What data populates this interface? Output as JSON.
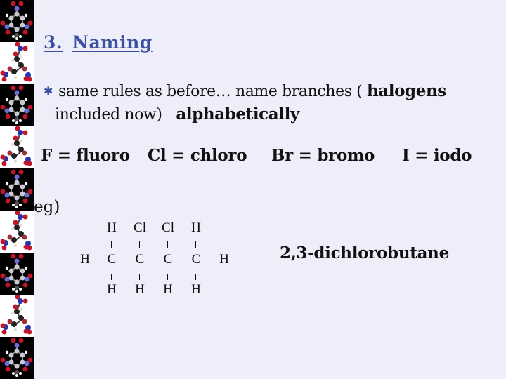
{
  "sidebar": {
    "tiles": [
      {
        "image": "tnt-molecule-icon",
        "background": "#000000"
      },
      {
        "image": "nitroglycerin-molecule-icon",
        "background": "#ffffff"
      },
      {
        "image": "tnt-molecule-icon",
        "background": "#000000"
      },
      {
        "image": "nitroglycerin-molecule-icon",
        "background": "#ffffff"
      },
      {
        "image": "tnt-molecule-icon",
        "background": "#000000"
      },
      {
        "image": "nitroglycerin-molecule-icon",
        "background": "#ffffff"
      },
      {
        "image": "tnt-molecule-icon",
        "background": "#000000"
      },
      {
        "image": "nitroglycerin-molecule-icon",
        "background": "#ffffff"
      },
      {
        "image": "tnt-molecule-icon",
        "background": "#000000"
      }
    ]
  },
  "slide": {
    "title_number": "3.",
    "title_text": "Naming",
    "title_color": "#3a4f9e",
    "bullet": {
      "icon": "star-bullet-icon",
      "text_part1": "same rules as before… name branches ( ",
      "text_bold1": "halogens",
      "text_part2": "included now)",
      "text_bold2": "alphabetically"
    },
    "halogens": [
      {
        "label": "F = fluoro"
      },
      {
        "label": "Cl = chloro"
      },
      {
        "label": "Br = bromo"
      },
      {
        "label": "I = iodo"
      }
    ],
    "example_label": "eg)",
    "structure": {
      "top": [
        "H",
        "Cl",
        "Cl",
        "H"
      ],
      "left_end": "H",
      "backbone": [
        "C",
        "C",
        "C",
        "C"
      ],
      "right_end": "H",
      "bottom": [
        "H",
        "H",
        "H",
        "H"
      ]
    },
    "compound_name": "2,3-dichlorobutane"
  }
}
